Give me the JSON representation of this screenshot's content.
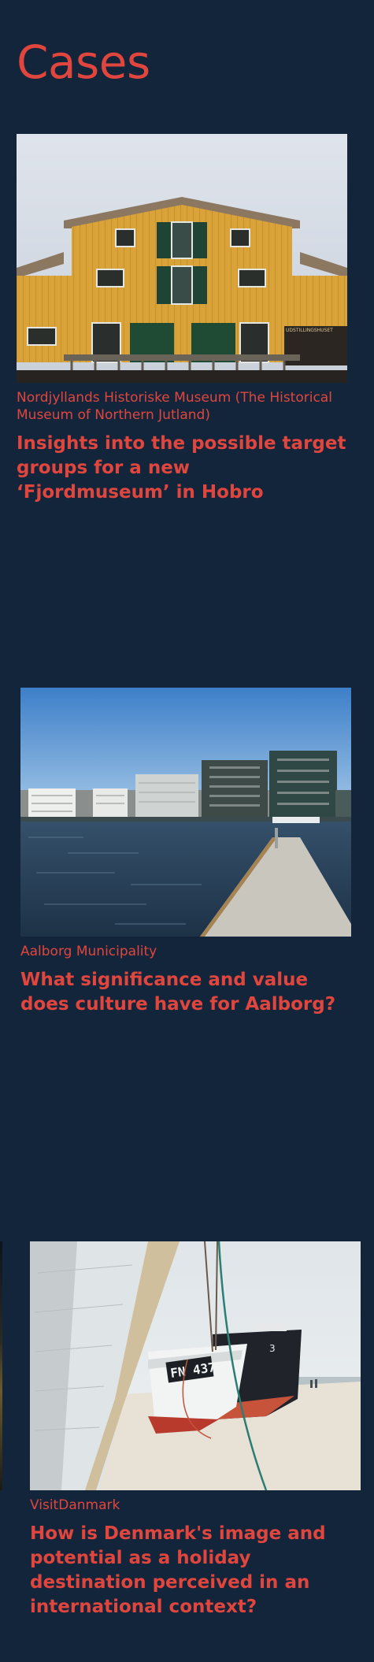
{
  "colors": {
    "background": "#13253a",
    "accent": "#e0463e"
  },
  "page": {
    "title": "Cases"
  },
  "cases": [
    {
      "client": "Nordjyllands Historiske Museum (The Historical Museum of Northern Jutland)",
      "title": "Insights into the possible target groups for a new ‘Fjordmuseum’ in Hobro",
      "sign_text": "UDSTILLINGSHUSET"
    },
    {
      "client": "Aalborg Municipality",
      "title": "What significance and value does culture have for Aalborg?"
    },
    {
      "client": "VisitDanmark",
      "title": "How is Denmark's image and potential as a holiday destination perceived in an international context?",
      "boat_registration": "FN 437",
      "boat_number": "3"
    }
  ]
}
